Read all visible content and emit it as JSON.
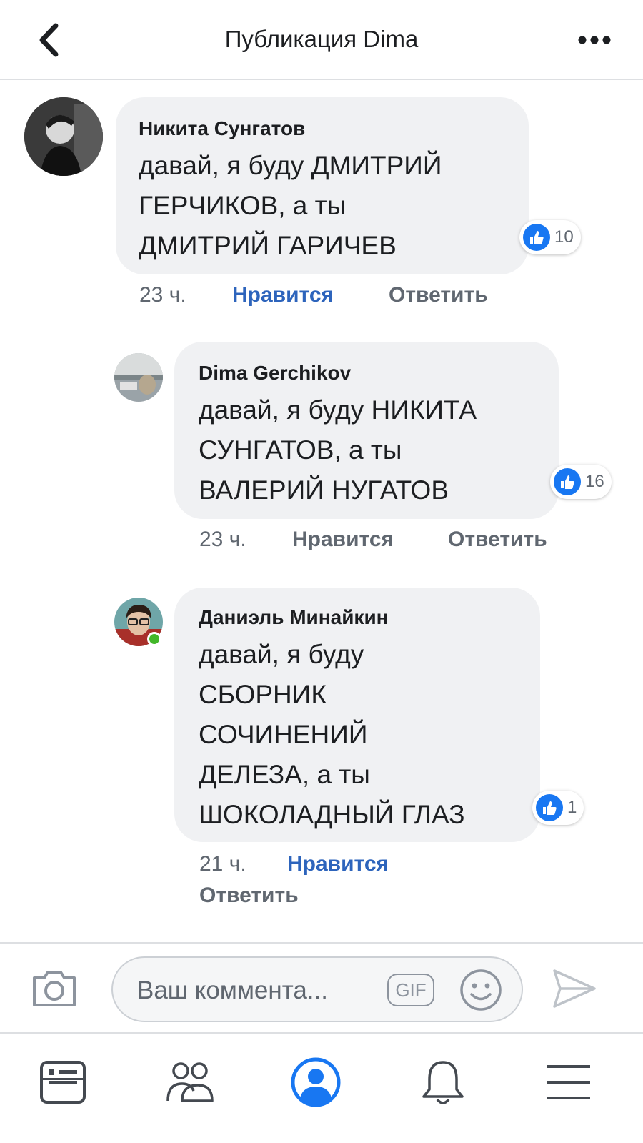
{
  "header": {
    "title": "Публикация Dima"
  },
  "comments": [
    {
      "author": "Никита Сунгатов",
      "lines": [
        "давай, я буду ДМИТРИЙ",
        "ГЕРЧИКОВ, а ты",
        "ДМИТРИЙ ГАРИЧЕВ"
      ],
      "likes": "10",
      "time": "23 ч.",
      "like_label": "Нравится",
      "reply_label": "Ответить"
    },
    {
      "author": "Dima Gerchikov",
      "lines": [
        "давай, я буду НИКИТА",
        "СУНГАТОВ, а ты",
        "ВАЛЕРИЙ НУГАТОВ"
      ],
      "likes": "16",
      "time": "23 ч.",
      "like_label": "Нравится",
      "reply_label": "Ответить"
    },
    {
      "author": "Даниэль Минайкин",
      "lines": [
        "давай, я буду",
        "СБОРНИК",
        "СОЧИНЕНИЙ",
        "ДЕЛЕЗА, а ты",
        "ШОКОЛАДНЫЙ ГЛАЗ"
      ],
      "likes": "1",
      "time": "21 ч.",
      "like_label": "Нравится",
      "reply_label": "Ответить"
    }
  ],
  "composer": {
    "placeholder": "Ваш коммента...",
    "gif_label": "GIF"
  },
  "nav": [
    "news-feed-icon",
    "friends-icon",
    "profile-icon",
    "notifications-icon",
    "menu-icon"
  ],
  "colors": {
    "accent": "#1877f2",
    "like_text": "#2d64bc",
    "bubble": "#f0f1f3",
    "online": "#42b72a"
  }
}
